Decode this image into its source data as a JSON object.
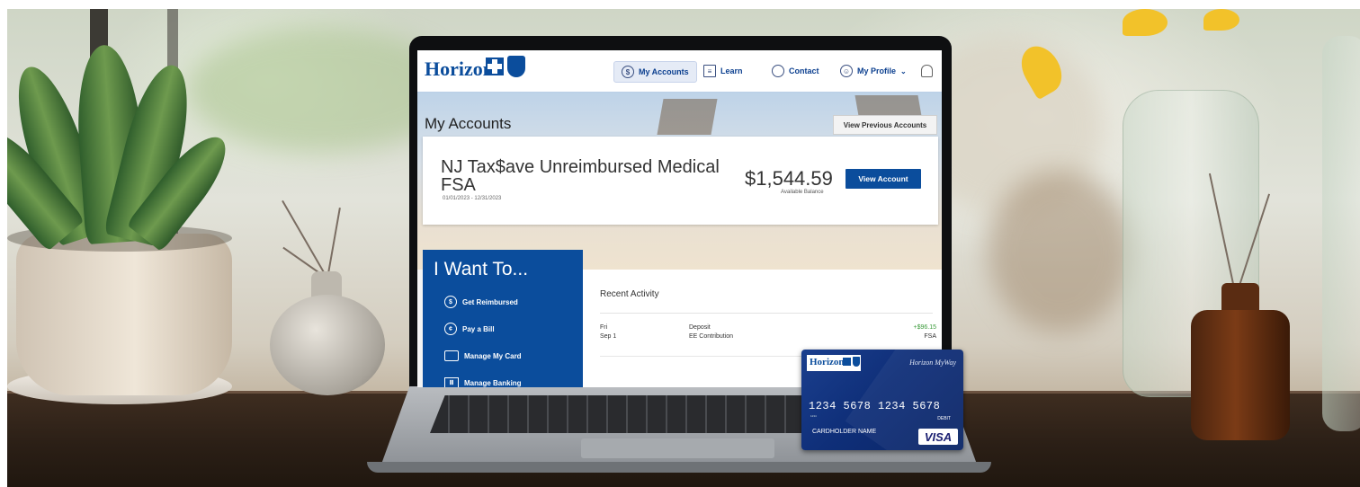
{
  "app": {
    "logo_text": "Horizon",
    "nav": {
      "my_accounts": "My Accounts",
      "learn": "Learn",
      "contact": "Contact",
      "my_profile": "My Profile"
    }
  },
  "hero": {
    "page_title": "My Accounts",
    "view_previous_label": "View Previous Accounts"
  },
  "account": {
    "name": "NJ Tax$ave Unreimbursed Medical FSA",
    "dates": "01/01/2023 - 12/31/2023",
    "balance": "$1,544.59",
    "balance_label": "Available Balance",
    "view_button": "View Account"
  },
  "want": {
    "title": "I Want To...",
    "items": [
      {
        "label": "Get Reimbursed",
        "icon": "dollar-circle-icon"
      },
      {
        "label": "Pay a Bill",
        "icon": "hand-coin-icon"
      },
      {
        "label": "Manage My Card",
        "icon": "card-icon"
      },
      {
        "label": "Manage Banking",
        "icon": "bank-icon"
      }
    ]
  },
  "activity": {
    "title": "Recent Activity",
    "rows": [
      {
        "day": "Fri",
        "date": "Sep 1",
        "type": "Deposit",
        "desc": "EE Contribution",
        "amount": "+$96.15",
        "account": "FSA"
      }
    ]
  },
  "card": {
    "logo_text": "Horizon",
    "brand": "Horizon MyWay",
    "number": "1234  5678  1234  5678",
    "small_text": "1234",
    "type": "DEBIT",
    "holder": "CARDHOLDER NAME",
    "network": "VISA"
  },
  "colors": {
    "brand_blue": "#0b4d9c",
    "positive_green": "#3a9b3a"
  }
}
